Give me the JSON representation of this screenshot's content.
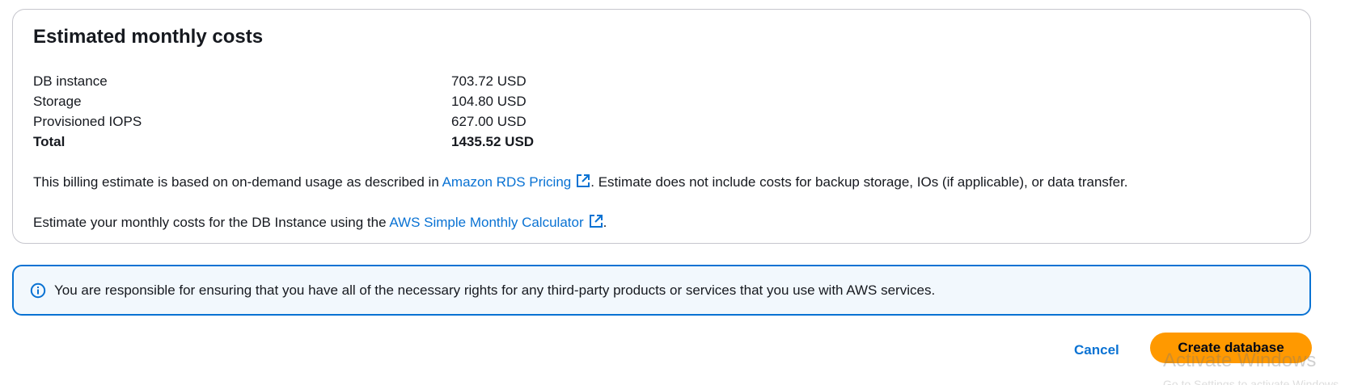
{
  "cost_panel": {
    "title": "Estimated monthly costs",
    "rows": [
      {
        "label": "DB instance",
        "value": "703.72 USD"
      },
      {
        "label": "Storage",
        "value": "104.80 USD"
      },
      {
        "label": "Provisioned IOPS",
        "value": "627.00 USD"
      },
      {
        "label": "Total",
        "value": "1435.52 USD"
      }
    ],
    "billing_note": {
      "prefix": "This billing estimate is based on on-demand usage as described in ",
      "link_text": "Amazon RDS Pricing",
      "suffix": ". Estimate does not include costs for backup storage, IOs (if applicable), or data transfer."
    },
    "calculator_note": {
      "prefix": "Estimate your monthly costs for the DB Instance using the ",
      "link_text": "AWS Simple Monthly Calculator",
      "suffix": "."
    }
  },
  "info_alert": {
    "text": "You are responsible for ensuring that you have all of the necessary rights for any third-party products or services that you use with AWS services."
  },
  "actions": {
    "cancel_label": "Cancel",
    "create_label": "Create database"
  },
  "watermark": {
    "title": "Activate Windows",
    "subtitle": "Go to Settings to activate Windows."
  },
  "colors": {
    "link": "#0972d3",
    "primary_button": "#ff9900",
    "alert_border": "#0972d3",
    "alert_background": "#f2f8fd"
  },
  "icons": {
    "external_link": "external-link-icon",
    "info": "info-icon"
  }
}
